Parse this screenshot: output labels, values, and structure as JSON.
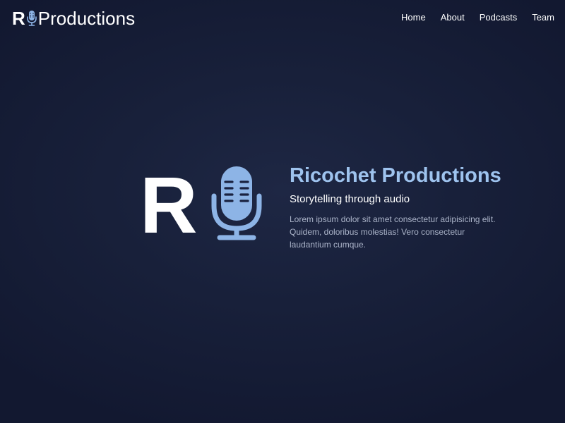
{
  "header": {
    "logo_letter": "R",
    "logo_text": "Productions",
    "nav": [
      {
        "label": "Home"
      },
      {
        "label": "About"
      },
      {
        "label": "Podcasts"
      },
      {
        "label": "Team"
      }
    ]
  },
  "hero": {
    "logo_letter": "R",
    "title": "Ricochet Productions",
    "subtitle": "Storytelling through audio",
    "body": "Lorem ipsum dolor sit amet consectetur adipisicing elit. Quidem, doloribus molestias! Vero consectetur laudantium cumque."
  },
  "icons": {
    "brand_mic": "microphone-icon",
    "hero_mic": "microphone-icon"
  },
  "colors": {
    "accent": "#9ec3ee",
    "mic_fill": "#8db4e6",
    "background": "#18203a",
    "body_text": "#aab3c8"
  }
}
